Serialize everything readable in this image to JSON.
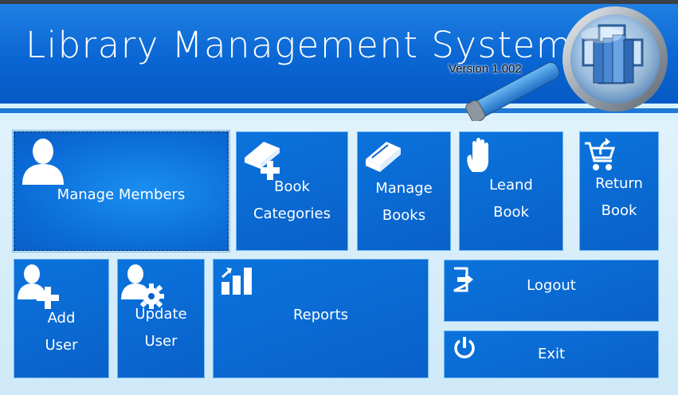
{
  "header": {
    "title": "Library Management System",
    "version": "Version 1.002"
  },
  "tiles": {
    "manage_members": {
      "label": "Manage Members",
      "icon": "member-icon"
    },
    "book_categories": {
      "line1": "Book",
      "line2": "Categories",
      "icon": "book-add-icon"
    },
    "manage_books": {
      "line1": "Manage",
      "line2": "Books",
      "icon": "book-icon"
    },
    "leand_book": {
      "line1": "Leand",
      "line2": "Book",
      "icon": "hand-icon"
    },
    "return_book": {
      "line1": "Return",
      "line2": "Book",
      "icon": "cart-return-icon"
    },
    "add_user": {
      "line1": "Add",
      "line2": "User",
      "icon": "user-add-icon"
    },
    "update_user": {
      "line1": "Update",
      "line2": "User",
      "icon": "user-gear-icon"
    },
    "reports": {
      "label": "Reports",
      "icon": "chart-icon"
    },
    "logout": {
      "label": "Logout",
      "icon": "logout-icon"
    },
    "exit": {
      "label": "Exit",
      "icon": "power-icon"
    }
  },
  "colors": {
    "header_blue": "#0a66d3",
    "tile_blue": "#0961c9",
    "tile_border": "#6fb5f0",
    "background": "#e9f6fd"
  }
}
